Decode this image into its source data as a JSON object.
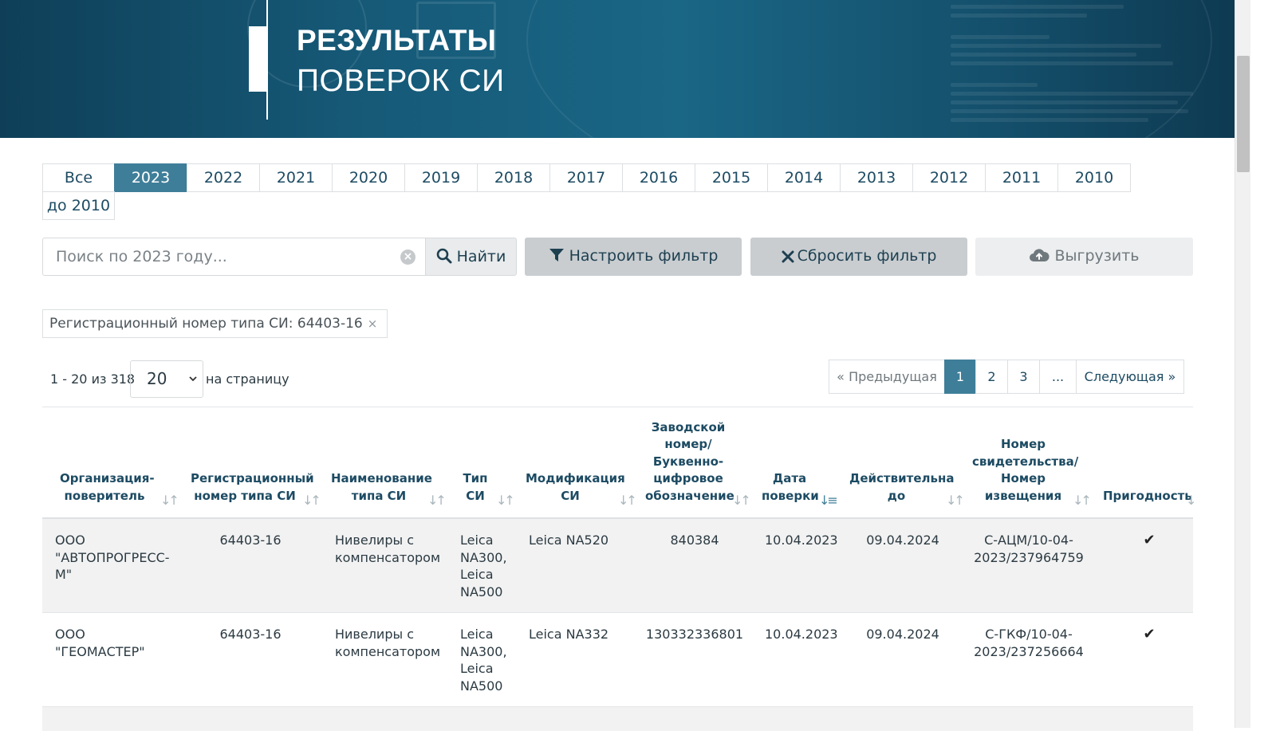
{
  "banner": {
    "title_line1": "РЕЗУЛЬТАТЫ",
    "title_line2": "ПОВЕРОК СИ"
  },
  "year_tabs": [
    "Все",
    "2023",
    "2022",
    "2021",
    "2020",
    "2019",
    "2018",
    "2017",
    "2016",
    "2015",
    "2014",
    "2013",
    "2012",
    "2011",
    "2010",
    "до 2010"
  ],
  "active_tab": "2023",
  "search": {
    "placeholder": "Поиск по 2023 году...",
    "value": ""
  },
  "buttons": {
    "find": "Найти",
    "configure_filter": "Настроить фильтр",
    "reset_filter": "Сбросить фильтр",
    "export": "Выгрузить"
  },
  "active_filter": {
    "label": "Регистрационный номер типа СИ: 64403-16",
    "remove": "×"
  },
  "results": {
    "range": "1 - 20 из 318",
    "per_page": "20",
    "per_page_label": "на страницу"
  },
  "pagination": {
    "prev": "Предыдущая",
    "pages": [
      "1",
      "2",
      "3",
      "..."
    ],
    "current": "1",
    "next": "Следующая"
  },
  "table": {
    "columns": [
      "Организация-поверитель",
      "Регистрационный номер типа СИ",
      "Наименование типа СИ",
      "Тип СИ",
      "Модификация СИ",
      "Заводской номер/ Буквенно-цифровое обозначение",
      "Дата поверки",
      "Действительна до",
      "Номер свидетельства/ Номер извещения",
      "Пригодность"
    ],
    "rows": [
      {
        "org": "ООО \"АВТОПРОГРЕСС-М\"",
        "reg_number": "64403-16",
        "type_name": "Нивелиры с компенсатором",
        "type": "Leica NA300, Leica NA500",
        "modification": "Leica NA520",
        "serial": "840384",
        "date": "10.04.2023",
        "valid_until": "09.04.2024",
        "certificate": "С-АЦМ/10-04-2023/237964759",
        "suitable": "✔"
      },
      {
        "org": "ООО \"ГЕОМАСТЕР\"",
        "reg_number": "64403-16",
        "type_name": "Нивелиры с компенсатором",
        "type": "Leica NA300, Leica NA500",
        "modification": "Leica NA332",
        "serial": "130332336801",
        "date": "10.04.2023",
        "valid_until": "09.04.2024",
        "certificate": "С-ГКФ/10-04-2023/237256664",
        "suitable": "✔"
      }
    ]
  },
  "icons": {
    "search": "magnifier-icon",
    "filter": "funnel-icon",
    "reset": "x-icon",
    "export": "cloud-upload-icon",
    "sort": "sort-arrows-icon",
    "check": "checkmark-icon"
  },
  "colors": {
    "accent": "#3f7e99",
    "banner": "#165a78",
    "header_text": "#1d4b63"
  }
}
